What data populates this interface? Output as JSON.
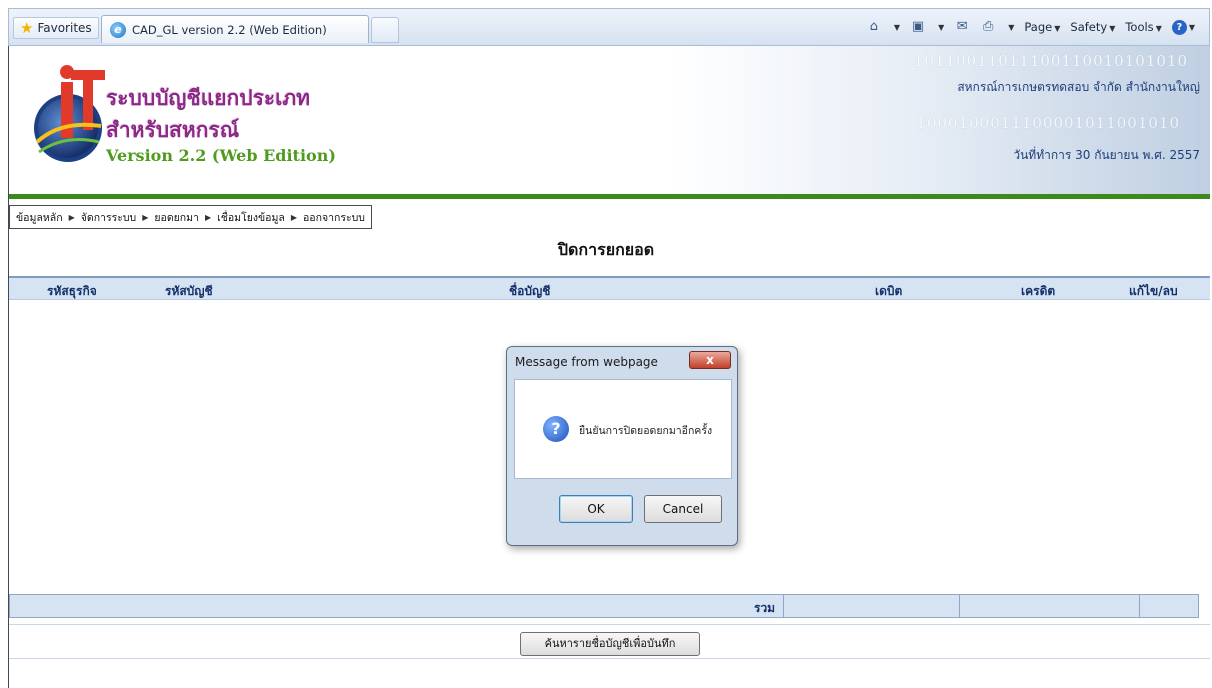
{
  "browser": {
    "favorites_label": "Favorites",
    "tab_title": "CAD_GL version 2.2 (Web Edition)",
    "command_bar": {
      "page_label": "Page",
      "safety_label": "Safety",
      "tools_label": "Tools"
    }
  },
  "header": {
    "title_line1": "ระบบบัญชีแยกประเภท",
    "title_line2": "สำหรับสหกรณ์",
    "version": "Version 2.2 (Web Edition)",
    "binary_decor": "10110011011100110010101010",
    "binary_decor2": "1000100011100001011001010",
    "organization": "สหกรณ์การเกษตรทดสอบ จำกัด สำนักงานใหญ่",
    "business_date": "วันที่ทำการ 30 กันยายน พ.ศ. 2557"
  },
  "menu": {
    "items": [
      "ข้อมูลหลัก",
      "จัดการระบบ",
      "ยอดยกมา",
      "เชื่อมโยงข้อมูล",
      "ออกจากระบบ"
    ]
  },
  "page": {
    "title": "ปิดการยกยอด"
  },
  "table": {
    "columns": [
      "รหัสธุรกิจ",
      "รหัสบัญชี",
      "ชื่อบัญชี",
      "เดบิต",
      "เครดิต",
      "แก้ไข/ลบ"
    ],
    "total_label": "รวม"
  },
  "search_button_label": "ค้นหารายชื่อบัญชีเพื่อบันทึก",
  "dialog": {
    "title": "Message from webpage",
    "message": "ยืนยันการปิดยอดยกมาอีกครั้ง",
    "ok_label": "OK",
    "cancel_label": "Cancel",
    "close_glyph": "x"
  },
  "colors": {
    "title_purple": "#8b2a86",
    "version_green": "#4e9b1e",
    "header_line_green": "#3c8a1c",
    "table_header_bg": "#d5e3f2"
  }
}
